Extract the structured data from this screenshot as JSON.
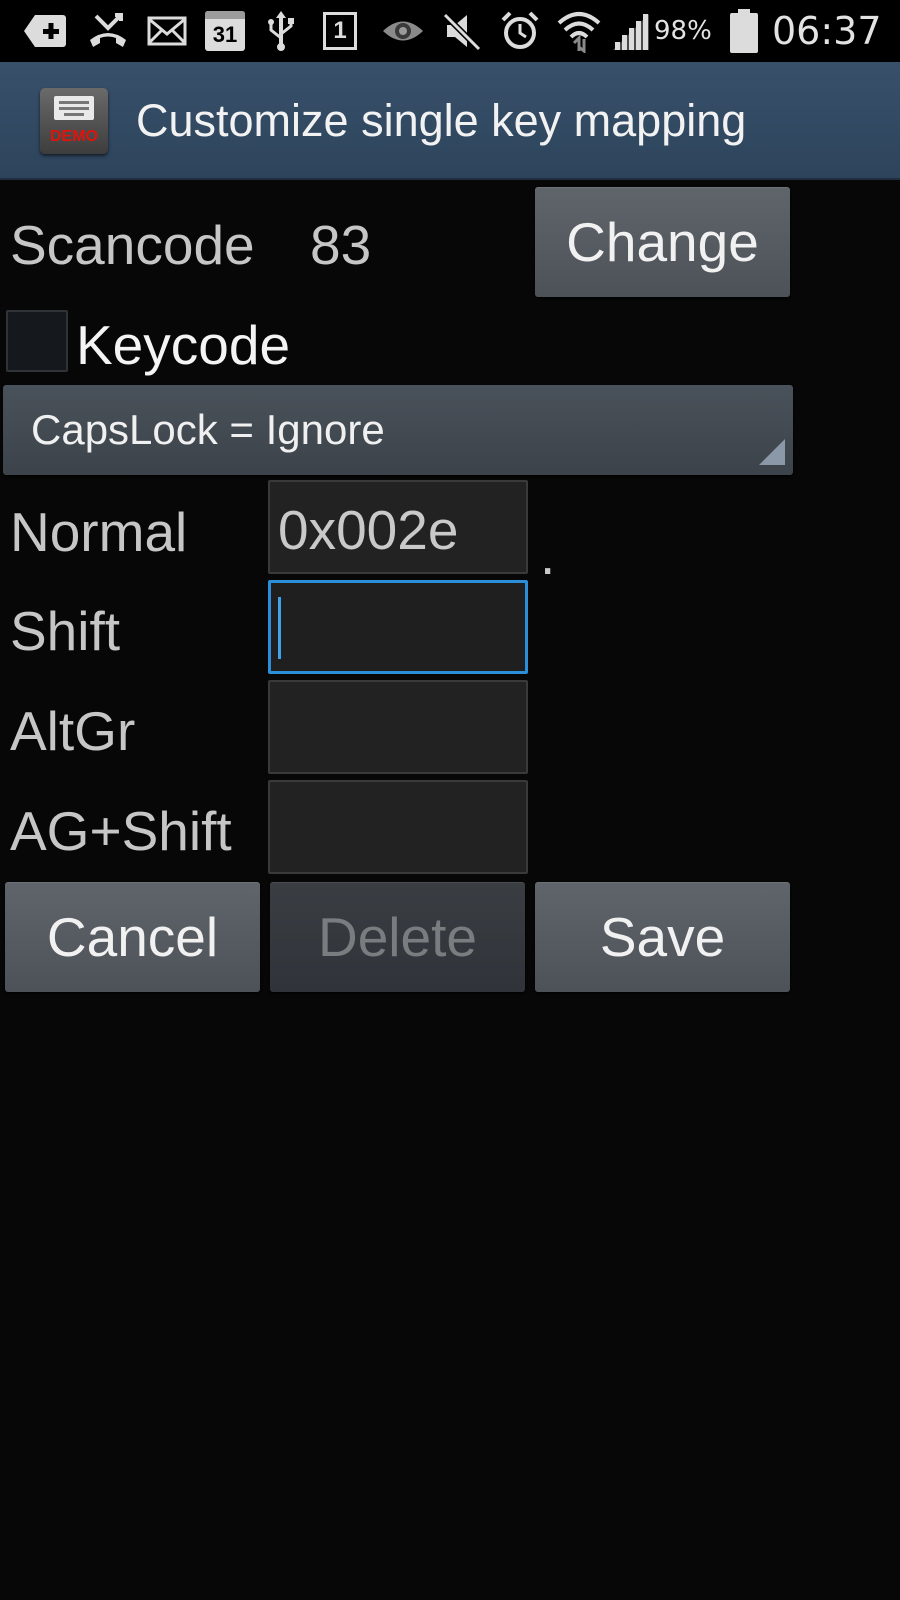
{
  "status_bar": {
    "icons": [
      "add-icon",
      "missed-call-icon",
      "mail-icon",
      "calendar-icon",
      "usb-icon",
      "sim-icon",
      "eye-icon",
      "mute-icon",
      "alarm-icon",
      "wifi-icon",
      "signal-icon",
      "battery-icon"
    ],
    "calendar_day": "31",
    "sim_number": "1",
    "battery_percent": "98%",
    "time": "06:37"
  },
  "action_bar": {
    "title": "Customize single key mapping",
    "app_icon_badge": "DEMO"
  },
  "scancode": {
    "label": "Scancode",
    "value": "83",
    "change_button": "Change"
  },
  "keycode": {
    "label": "Keycode",
    "checked": false
  },
  "capslock_spinner": {
    "selected": "CapsLock = Ignore"
  },
  "mappings": [
    {
      "label": "Normal",
      "value": "0x002e",
      "preview": "."
    },
    {
      "label": "Shift",
      "value": ""
    },
    {
      "label": "AltGr",
      "value": ""
    },
    {
      "label": "AG+Shift",
      "value": ""
    }
  ],
  "buttons": {
    "cancel": "Cancel",
    "delete": "Delete",
    "save": "Save"
  },
  "colors": {
    "background": "#070707",
    "action_bar": "#34495f",
    "focus": "#2a8fd8",
    "demo_red": "#e3120b"
  }
}
